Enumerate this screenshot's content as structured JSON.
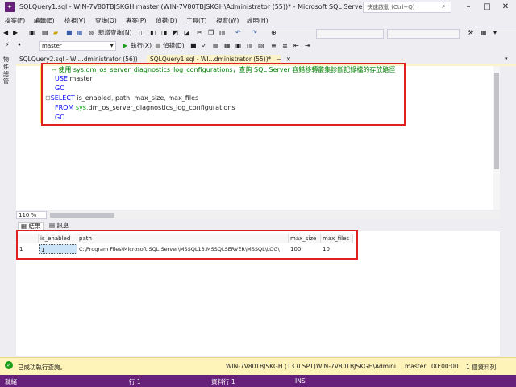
{
  "window": {
    "title": "SQLQuery1.sql - WIN-7V80TBJSKGH.master (WIN-7V80TBJSKGH\\Administrator (55))* - Microsoft SQL Server Manage...",
    "quick_launch_placeholder": "快速啟動 (Ctrl+Q)"
  },
  "menu": [
    "檔案(F)",
    "編輯(E)",
    "檢視(V)",
    "查詢(Q)",
    "專案(P)",
    "偵錯(D)",
    "工具(T)",
    "視窗(W)",
    "說明(H)"
  ],
  "toolbar": {
    "new_query": "新增查詢(N)",
    "execute": "執行(X)",
    "debug": "偵錯(D)",
    "database": "master"
  },
  "sidebar": {
    "label": "物件總管"
  },
  "tabs": [
    {
      "label": "SQLQuery2.sql - WI...dministrator (56))"
    },
    {
      "label": "SQLQuery1.sql - WI...dministrator (55))*",
      "pin": "⊣",
      "close": "✕"
    }
  ],
  "editor": {
    "lines": [
      {
        "parts": [
          {
            "cls": "cm",
            "text": "-- 使用 sys.dm_os_server_diagnostics_log_configurations，查詢 SQL Server 容錯移轉叢集診斷記錄檔的存放路徑"
          }
        ]
      },
      {
        "parts": [
          {
            "cls": "kw",
            "text": "USE"
          },
          {
            "cls": "",
            "text": " master"
          }
        ]
      },
      {
        "parts": [
          {
            "cls": "kw",
            "text": "GO"
          }
        ]
      },
      {
        "parts": [
          {
            "cls": "gr",
            "text": "⊟"
          },
          {
            "cls": "kw",
            "text": "SELECT"
          },
          {
            "cls": "",
            "text": " is_enabled"
          },
          {
            "cls": "gr",
            "text": ","
          },
          {
            "cls": "",
            "text": " path"
          },
          {
            "cls": "gr",
            "text": ","
          },
          {
            "cls": "",
            "text": " max_size"
          },
          {
            "cls": "gr",
            "text": ","
          },
          {
            "cls": "",
            "text": " max_files"
          }
        ]
      },
      {
        "parts": [
          {
            "cls": "kw",
            "text": "FROM"
          },
          {
            "cls": "sys",
            "text": " sys"
          },
          {
            "cls": "gr",
            "text": "."
          },
          {
            "cls": "",
            "text": "dm_os_server_diagnostics_log_configurations"
          }
        ]
      },
      {
        "parts": [
          {
            "cls": "kw",
            "text": "GO"
          }
        ]
      }
    ]
  },
  "zoom": "110 %",
  "result_tabs": {
    "results": "結果",
    "messages": "訊息"
  },
  "results": {
    "columns": [
      "is_enabled",
      "path",
      "max_size",
      "max_files"
    ],
    "rows": [
      {
        "num": "1",
        "is_enabled": "1",
        "path": "C:\\Program Files\\Microsoft SQL Server\\MSSQL13.MSSQLSERVER\\MSSQL\\LOG\\",
        "max_size": "100",
        "max_files": "10"
      }
    ]
  },
  "exec_status": {
    "message": "已成功執行查詢。",
    "server": "WIN-7V80TBJSKGH (13.0 SP1)",
    "user": "WIN-7V80TBJSKGH\\Admini...",
    "database": "master",
    "time": "00:00:00",
    "rows": "1 個資料列"
  },
  "statusbar": {
    "ready": "就緒",
    "line": "行 1",
    "col": "資料行 1",
    "mode": "INS"
  },
  "colors": {
    "accent": "#68217a",
    "highlight": "#e02020",
    "tab_active": "#fcf3c8"
  }
}
